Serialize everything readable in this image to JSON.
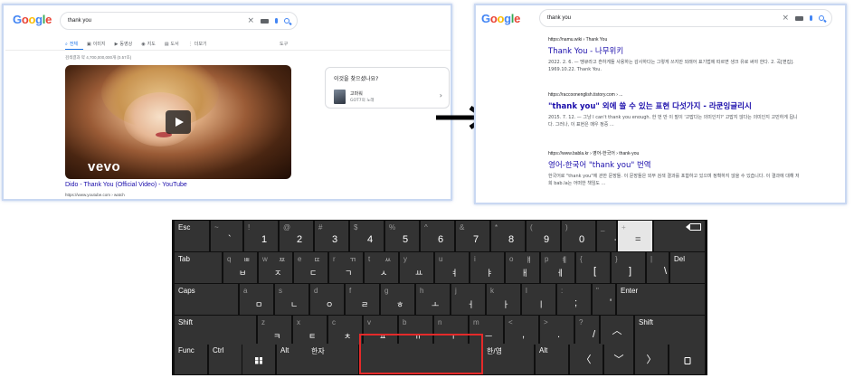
{
  "left_panel": {
    "logo": "Google",
    "query": "thank you",
    "tabs": [
      {
        "icon": "search-icon",
        "glyph": "⌕",
        "label": "전체",
        "active": true
      },
      {
        "icon": "image-icon",
        "glyph": "▣",
        "label": "이미지",
        "active": false
      },
      {
        "icon": "video-icon",
        "glyph": "▶",
        "label": "동영상",
        "active": false
      },
      {
        "icon": "map-pin-icon",
        "glyph": "◉",
        "label": "지도",
        "active": false
      },
      {
        "icon": "book-icon",
        "glyph": "▤",
        "label": "도서",
        "active": false
      },
      {
        "icon": "more-icon",
        "glyph": "⋮",
        "label": "더보기",
        "active": false
      }
    ],
    "tools": "도구",
    "result_stats": "검색결과 약 4,700,000,000개 (0.57초)",
    "video": {
      "brand": "vevo",
      "title": "Dido - Thank You (Official Video) - YouTube",
      "url": "https://www.youtube.com › watch"
    },
    "side_card": {
      "heading": "이것을 찾으셨나요?",
      "name": "고마워",
      "subtitle": "GOT7의 노래"
    }
  },
  "right_panel": {
    "logo": "Google",
    "query": "thank you",
    "results": [
      {
        "url": "https://namu.wiki › Thank You",
        "title": "Thank You - 나무위키",
        "snippet": "2022. 2. 6. — 땡큐라고 흔하게들 사용하는 감사하다는 그렇게 쓰지만 외래어 표기법에 따르면 생크 유로 써야 한다. 2. 곡[편집]. 1969.10.22. Thank You."
      },
      {
        "url": "https://raccoonenglish.tistory.com › ...",
        "title": "\"thank you\" 외에 쓸 수 있는 표현 다섯가지 - 라쿤잉글리시",
        "snippet": "2015. 7. 12. — 그냥 I can't thank you enough. 한 번 만 이 말이 '고맙다는 의미인지?' 고맙지 않다는 의미인지 고민하게 됩니다. 그러나, 이 표현은 매우 정중 ..."
      },
      {
        "url": "https://www.babla.kr › 영어-한국어 › thank-you",
        "title": "영어-한국어 \"thank you\" 번역",
        "snippet": "한국어로 \"thank you\"에 관한 문장들. 이 문장들은 외부 검색 결과를 포함하고 있으며 정확하지 않을 수 있습니다. 이 결과에 대해 저희 bab.la는 어떠한 책임도 ..."
      }
    ]
  },
  "keyboard": {
    "row1": [
      {
        "lbl": "Esc"
      },
      {
        "sym": "~",
        "main": "`"
      },
      {
        "sym": "!",
        "main": "1"
      },
      {
        "sym": "@",
        "main": "2"
      },
      {
        "sym": "#",
        "main": "3"
      },
      {
        "sym": "$",
        "main": "4"
      },
      {
        "sym": "%",
        "main": "5"
      },
      {
        "sym": "^",
        "main": "6"
      },
      {
        "sym": "&",
        "main": "7"
      },
      {
        "sym": "*",
        "main": "8"
      },
      {
        "sym": "(",
        "main": "9"
      },
      {
        "sym": ")",
        "main": "0"
      },
      {
        "sym": "_",
        "main": "-"
      },
      {
        "sym": "+",
        "main": "="
      },
      {
        "lbl": ""
      }
    ],
    "row2": [
      {
        "lbl": "Tab"
      },
      {
        "sym": "q",
        "hj": "ㅃ",
        "hj2": "ㅂ"
      },
      {
        "sym": "w",
        "hj": "ㅉ",
        "hj2": "ㅈ"
      },
      {
        "sym": "e",
        "hj": "ㄸ",
        "hj2": "ㄷ"
      },
      {
        "sym": "r",
        "hj": "ㄲ",
        "hj2": "ㄱ"
      },
      {
        "sym": "t",
        "hj": "ㅆ",
        "hj2": "ㅅ"
      },
      {
        "sym": "y",
        "hj": "",
        "hj2": "ㅛ"
      },
      {
        "sym": "u",
        "hj": "",
        "hj2": "ㅕ"
      },
      {
        "sym": "i",
        "hj": "",
        "hj2": "ㅑ"
      },
      {
        "sym": "o",
        "hj": "ㅒ",
        "hj2": "ㅐ"
      },
      {
        "sym": "p",
        "hj": "ㅖ",
        "hj2": "ㅔ"
      },
      {
        "sym": "{",
        "main": "["
      },
      {
        "sym": "}",
        "main": "]"
      },
      {
        "sym": "|",
        "main": "\\"
      },
      {
        "lbl": "Del"
      }
    ],
    "row3": [
      {
        "lbl": "Caps"
      },
      {
        "sym": "a",
        "hj2": "ㅁ"
      },
      {
        "sym": "s",
        "hj2": "ㄴ"
      },
      {
        "sym": "d",
        "hj2": "ㅇ"
      },
      {
        "sym": "f",
        "hj2": "ㄹ"
      },
      {
        "sym": "g",
        "hj2": "ㅎ"
      },
      {
        "sym": "h",
        "hj2": "ㅗ"
      },
      {
        "sym": "j",
        "hj2": "ㅓ"
      },
      {
        "sym": "k",
        "hj2": "ㅏ"
      },
      {
        "sym": "l",
        "hj2": "ㅣ"
      },
      {
        "sym": ":",
        "main": ";"
      },
      {
        "sym": "\"",
        "main": "'"
      },
      {
        "lbl": "Enter"
      }
    ],
    "row4": [
      {
        "lbl": "Shift"
      },
      {
        "sym": "z",
        "hj2": "ㅋ"
      },
      {
        "sym": "x",
        "hj2": "ㅌ"
      },
      {
        "sym": "c",
        "hj2": "ㅊ"
      },
      {
        "sym": "v",
        "hj2": "ㅍ"
      },
      {
        "sym": "b",
        "hj2": "ㅠ"
      },
      {
        "sym": "n",
        "hj2": "ㅜ"
      },
      {
        "sym": "m",
        "hj2": "ㅡ"
      },
      {
        "sym": "<",
        "main": ","
      },
      {
        "sym": ">",
        "main": "."
      },
      {
        "sym": "?",
        "main": "/"
      },
      {
        "lbl": "",
        "mid": "︿"
      },
      {
        "lbl": "Shift"
      }
    ],
    "row5": [
      {
        "lbl": "Func"
      },
      {
        "lbl": "Ctrl"
      },
      {
        "lbl": "",
        "win": true
      },
      {
        "lbl": "Alt"
      },
      {
        "lbl": "한자"
      },
      {
        "lbl": ""
      },
      {
        "lbl": "한/영"
      },
      {
        "lbl": "Alt"
      },
      {
        "lbl": "",
        "mid": "〈"
      },
      {
        "lbl": "",
        "mid": "﹀"
      },
      {
        "lbl": "",
        "mid": "〉"
      },
      {
        "lbl": "",
        "clip": true
      }
    ],
    "colors": {
      "key": "#333333",
      "pressed_key": "#e6e6e6",
      "highlight": "#e52a2a"
    }
  }
}
